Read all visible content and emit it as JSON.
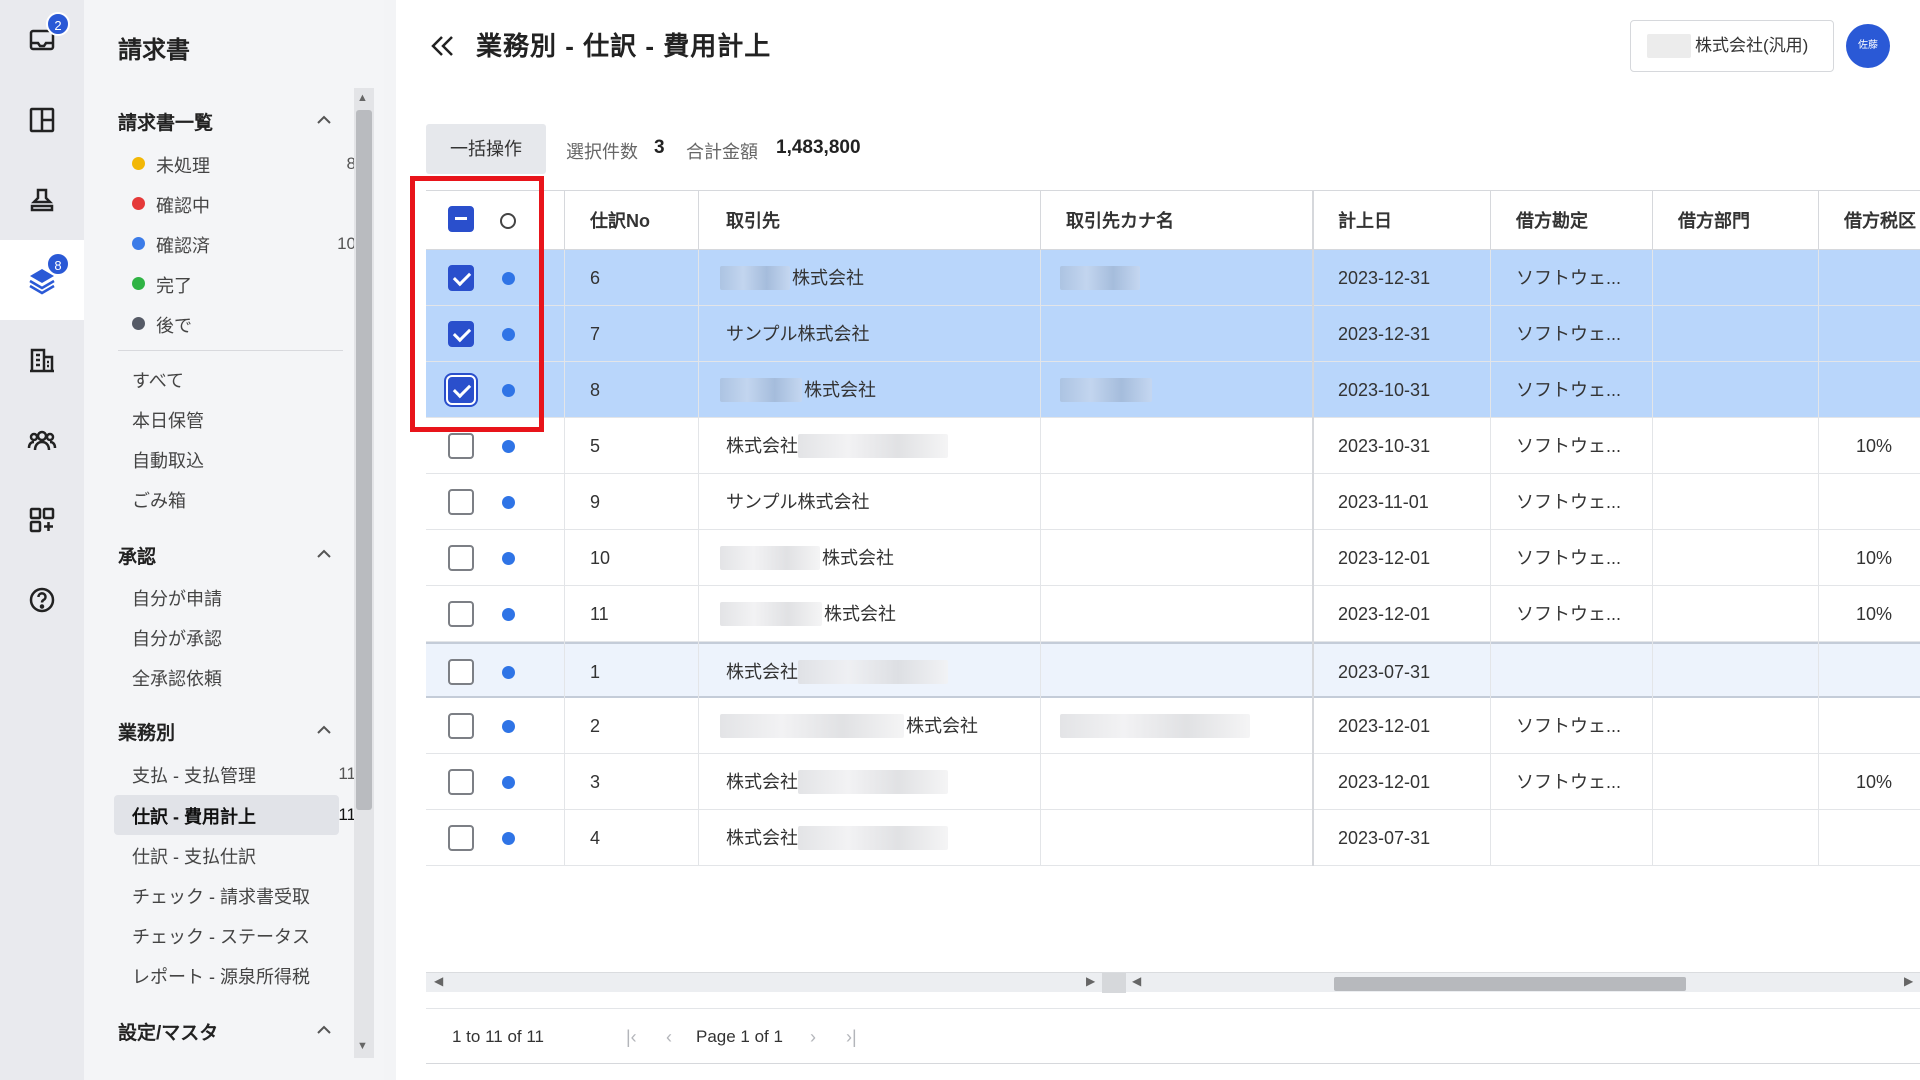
{
  "rail": {
    "items": [
      {
        "icon": "inbox-icon",
        "badge": "2"
      },
      {
        "icon": "layout-icon",
        "badge": ""
      },
      {
        "icon": "stamp-icon",
        "badge": ""
      },
      {
        "icon": "layers-icon",
        "badge": "8"
      },
      {
        "icon": "building-icon",
        "badge": ""
      },
      {
        "icon": "users-icon",
        "badge": ""
      },
      {
        "icon": "apps-icon",
        "badge": ""
      },
      {
        "icon": "help-icon",
        "badge": ""
      }
    ]
  },
  "sidebar": {
    "title": "請求書",
    "section_list": "請求書一覧",
    "statuses": [
      {
        "label": "未処理",
        "count": "8",
        "color": "#f2b705"
      },
      {
        "label": "確認中",
        "count": "",
        "color": "#e53939"
      },
      {
        "label": "確認済",
        "count": "10",
        "color": "#3b7be8"
      },
      {
        "label": "完了",
        "count": "",
        "color": "#2fb344"
      },
      {
        "label": "後で",
        "count": "",
        "color": "#555a66"
      }
    ],
    "misc": [
      "すべて",
      "本日保管",
      "自動取込",
      "ごみ箱"
    ],
    "section_approval": "承認",
    "approval_items": [
      "自分が申請",
      "自分が承認",
      "全承認依頼"
    ],
    "section_business": "業務別",
    "business_items": [
      {
        "label": "支払 - 支払管理",
        "count": "11"
      },
      {
        "label": "仕訳 - 費用計上",
        "count": "11"
      },
      {
        "label": "仕訳 - 支払仕訳",
        "count": ""
      },
      {
        "label": "チェック - 請求書受取",
        "count": ""
      },
      {
        "label": "チェック - ステータス",
        "count": ""
      },
      {
        "label": "レポート - 源泉所得税",
        "count": ""
      }
    ],
    "section_settings": "設定/マスタ"
  },
  "header": {
    "title": "業務別 - 仕訳 - 費用計上",
    "company": "株式会社(汎用)",
    "avatar": "佐藤"
  },
  "toolbar": {
    "bulk_label": "一括操作",
    "selected_count_label": "選択件数",
    "selected_count": "3",
    "total_label": "合計金額",
    "total_amount": "1,483,800"
  },
  "table": {
    "columns": [
      "仕訳No",
      "取引先",
      "取引先カナ名",
      "計上日",
      "借方勘定",
      "借方部門",
      "借方税区"
    ],
    "rows": [
      {
        "no": "6",
        "vendor": "株式会社",
        "date": "2023-12-31",
        "account": "ソフトウェ...",
        "tax": "",
        "selected": true
      },
      {
        "no": "7",
        "vendor": "サンプル株式会社",
        "date": "2023-12-31",
        "account": "ソフトウェ...",
        "tax": "",
        "selected": true
      },
      {
        "no": "8",
        "vendor": "株式会社",
        "date": "2023-10-31",
        "account": "ソフトウェ...",
        "tax": "",
        "selected": true
      },
      {
        "no": "5",
        "vendor": "株式会社",
        "date": "2023-10-31",
        "account": "ソフトウェ...",
        "tax": "10%",
        "selected": false
      },
      {
        "no": "9",
        "vendor": "サンプル株式会社",
        "date": "2023-11-01",
        "account": "ソフトウェ...",
        "tax": "",
        "selected": false
      },
      {
        "no": "10",
        "vendor": "株式会社",
        "date": "2023-12-01",
        "account": "ソフトウェ...",
        "tax": "10%",
        "selected": false
      },
      {
        "no": "11",
        "vendor": "株式会社",
        "date": "2023-12-01",
        "account": "ソフトウェ...",
        "tax": "10%",
        "selected": false
      },
      {
        "no": "1",
        "vendor": "株式会社",
        "date": "2023-07-31",
        "account": "",
        "tax": "",
        "selected": false
      },
      {
        "no": "2",
        "vendor": "株式会社",
        "date": "2023-12-01",
        "account": "ソフトウェ...",
        "tax": "",
        "selected": false
      },
      {
        "no": "3",
        "vendor": "株式会社",
        "date": "2023-12-01",
        "account": "ソフトウェ...",
        "tax": "10%",
        "selected": false
      },
      {
        "no": "4",
        "vendor": "株式会社",
        "date": "2023-07-31",
        "account": "",
        "tax": "",
        "selected": false
      }
    ]
  },
  "pagination": {
    "range": "1 to 11 of 11",
    "page": "Page 1 of 1"
  },
  "colors": {
    "accent": "#2a4fcc",
    "selected_row": "#b9d6fb",
    "highlight": "#e8141a"
  }
}
